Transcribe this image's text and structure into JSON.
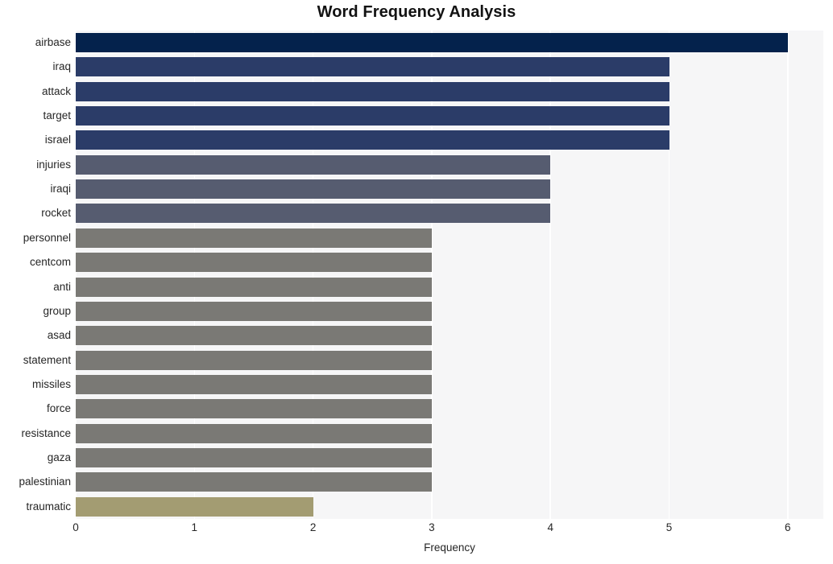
{
  "chart_data": {
    "type": "bar",
    "orientation": "horizontal",
    "title": "Word Frequency Analysis",
    "xlabel": "Frequency",
    "ylabel": "",
    "xlim": [
      0,
      6.3
    ],
    "xticks": [
      "0",
      "1",
      "2",
      "3",
      "4",
      "5",
      "6"
    ],
    "xtick_values": [
      0,
      1,
      2,
      3,
      4,
      5,
      6
    ],
    "grid": "vertical-white",
    "legend": "none",
    "categories": [
      "airbase",
      "iraq",
      "attack",
      "target",
      "israel",
      "injuries",
      "iraqi",
      "rocket",
      "personnel",
      "centcom",
      "anti",
      "group",
      "asad",
      "statement",
      "missiles",
      "force",
      "resistance",
      "gaza",
      "palestinian",
      "traumatic"
    ],
    "values": [
      6,
      5,
      5,
      5,
      5,
      4,
      4,
      4,
      3,
      3,
      3,
      3,
      3,
      3,
      3,
      3,
      3,
      3,
      3,
      2
    ],
    "bar_colors": [
      "#04224c",
      "#2b3c68",
      "#2b3c68",
      "#2b3c68",
      "#2b3c68",
      "#565c70",
      "#565c70",
      "#565c70",
      "#7a7975",
      "#7a7975",
      "#7a7975",
      "#7a7975",
      "#7a7975",
      "#7a7975",
      "#7a7975",
      "#7a7975",
      "#7a7975",
      "#7a7975",
      "#7a7975",
      "#a39c72"
    ]
  },
  "style": {
    "plot_background": "#f6f6f7",
    "figure_background": "#ffffff",
    "gridline_color": "#ffffff",
    "title_color": "#121212",
    "tick_label_color": "#262626"
  }
}
